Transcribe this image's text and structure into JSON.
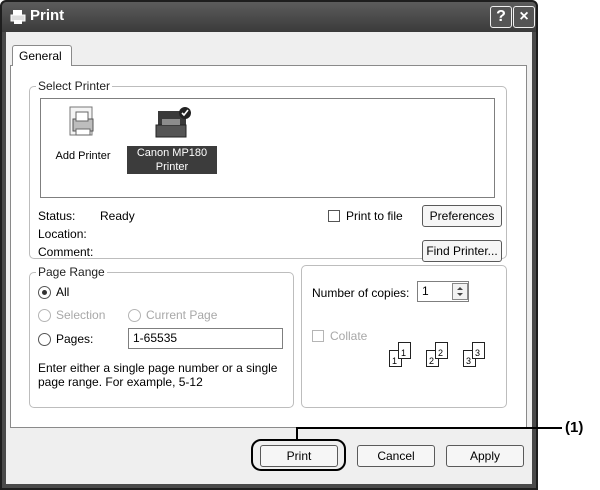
{
  "window": {
    "title": "Print",
    "help_btn": "?",
    "close_btn": "×"
  },
  "tabs": [
    {
      "label": "General"
    }
  ],
  "select_printer": {
    "legend": "Select Printer",
    "printers": [
      {
        "label": "Add Printer",
        "selected": false
      },
      {
        "label": "Canon MP180 Printer",
        "selected": true
      }
    ],
    "status_label": "Status:",
    "status_value": "Ready",
    "location_label": "Location:",
    "comment_label": "Comment:",
    "print_to_file_label": "Print to file",
    "preferences_button": "Preferences",
    "find_printer_button": "Find Printer..."
  },
  "page_range": {
    "legend": "Page Range",
    "all_label": "All",
    "selection_label": "Selection",
    "current_page_label": "Current Page",
    "pages_label": "Pages:",
    "pages_value": "1-65535",
    "hint": "Enter either a single page number or a single page range.  For example, 5-12"
  },
  "copies": {
    "label": "Number of copies:",
    "value": "1",
    "collate_label": "Collate",
    "collate_pages": [
      "1",
      "1",
      "2",
      "2",
      "3",
      "3"
    ]
  },
  "buttons": {
    "print": "Print",
    "cancel": "Cancel",
    "apply": "Apply"
  },
  "callout": {
    "label": "(1)"
  },
  "colors": {
    "titlebar": "#4a4a4a",
    "selection": "#3c3c3c"
  }
}
